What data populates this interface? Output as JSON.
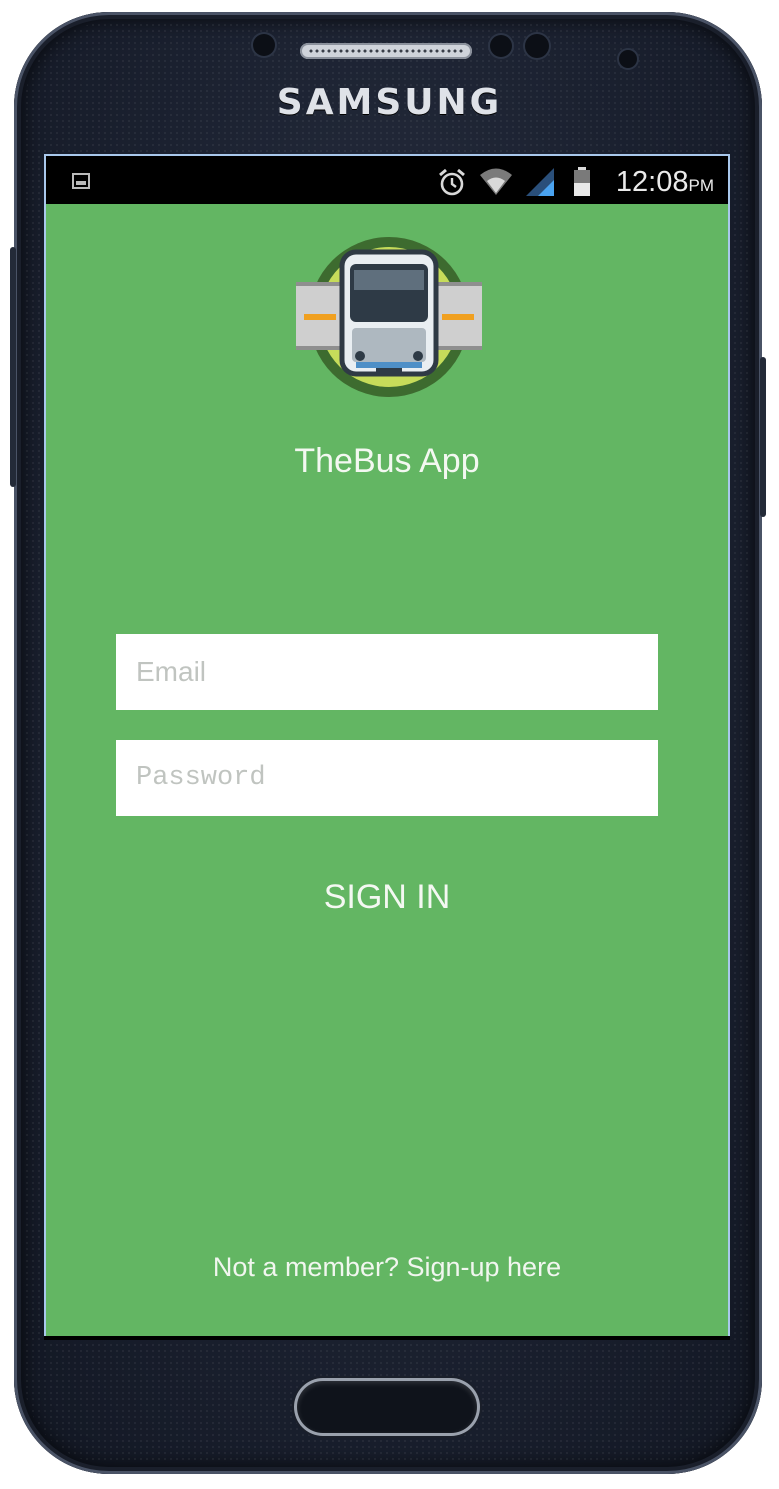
{
  "device": {
    "brand": "SAMSUNG"
  },
  "status_bar": {
    "time": "12:08",
    "ampm": "PM",
    "icons": [
      "notification-image-icon",
      "alarm-icon",
      "wifi-icon",
      "cellular-signal-icon",
      "battery-icon"
    ]
  },
  "app": {
    "title": "TheBus App",
    "logo": "bus-logo-icon",
    "background_color": "#63b663"
  },
  "login": {
    "email_placeholder": "Email",
    "password_placeholder": "Password",
    "signin_label": "SIGN IN",
    "signup_link": "Not a member? Sign-up here"
  }
}
